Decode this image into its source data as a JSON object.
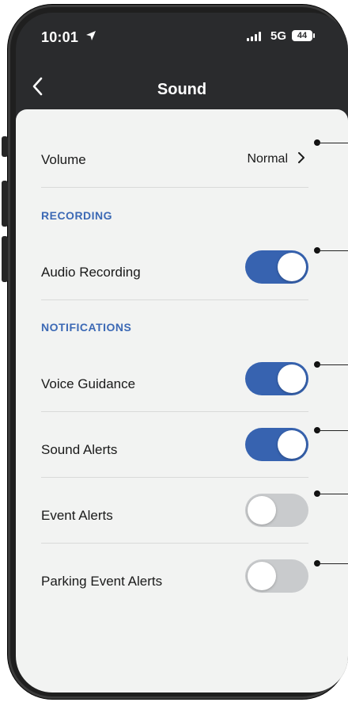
{
  "status_bar": {
    "time": "10:01",
    "network": "5G",
    "battery": "44"
  },
  "nav": {
    "title": "Sound"
  },
  "volume": {
    "label": "Volume",
    "value": "Normal"
  },
  "sections": {
    "recording": "RECORDING",
    "notifications": "NOTIFICATIONS"
  },
  "settings": [
    {
      "label": "Audio Recording",
      "on": true
    },
    {
      "label": "Voice Guidance",
      "on": true
    },
    {
      "label": "Sound Alerts",
      "on": true
    },
    {
      "label": "Event Alerts",
      "on": false
    },
    {
      "label": "Parking Event Alerts",
      "on": false
    }
  ],
  "colors": {
    "accent": "#3763b0",
    "section_text": "#3c69b5",
    "toggle_off": "#c9cbcd",
    "header": "#2a2b2d",
    "sheet": "#f2f3f2"
  }
}
